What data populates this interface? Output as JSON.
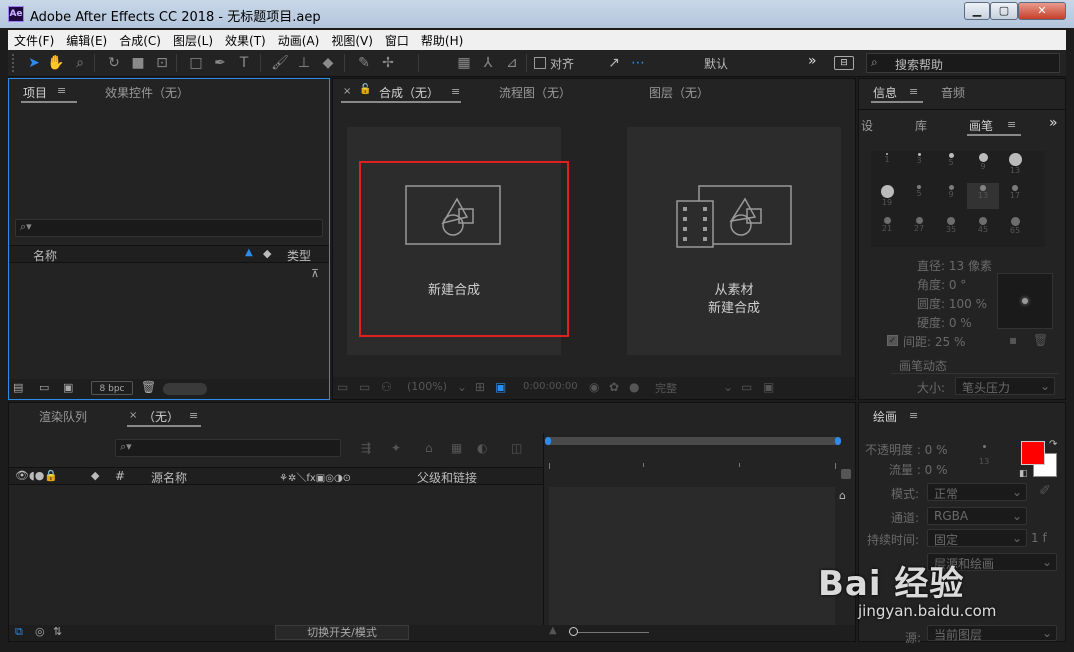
{
  "window": {
    "title": "Adobe After Effects CC 2018 - 无标题项目.aep",
    "logo": "Ae"
  },
  "menu": [
    "文件(F)",
    "编辑(E)",
    "合成(C)",
    "图层(L)",
    "效果(T)",
    "动画(A)",
    "视图(V)",
    "窗口",
    "帮助(H)"
  ],
  "toolbar": {
    "align_label": "对齐",
    "workspace": "默认",
    "search_placeholder": "搜索帮助"
  },
  "project_panel": {
    "tab_project": "项目",
    "tab_effects": "效果控件（无）",
    "col_name": "名称",
    "col_type": "类型",
    "bpc": "8 bpc"
  },
  "comp_panel": {
    "tab_comp": "合成（无）",
    "tab_flow": "流程图（无）",
    "tab_layer": "图层（无）",
    "new_comp": "新建合成",
    "from_footage_1": "从素材",
    "from_footage_2": "新建合成",
    "zoom": "(100%)",
    "timecode": "0:00:00:00",
    "quality": "完整"
  },
  "right_panel": {
    "tab_info": "信息",
    "tab_audio": "音频",
    "tab_settings": "设",
    "tab_library": "库",
    "tab_brush": "画笔",
    "brush_sizes": [
      "1",
      "3",
      "5",
      "9",
      "13",
      "19",
      "5",
      "9",
      "13",
      "17",
      "21",
      "27",
      "35",
      "45",
      "65"
    ],
    "diameter": "直径: 13 像素",
    "angle": "角度: 0 °",
    "roundness": "圆度: 100 %",
    "hardness": "硬度: 0 %",
    "spacing": "间距:   25 %",
    "brush_dynamics": "画笔动态",
    "size_label": "大小:",
    "size_value": "笔头压力"
  },
  "paint_panel": {
    "title": "绘画",
    "opacity": "不透明度 : 0 %",
    "flow": "流量 : 0 %",
    "mode_label": "模式:",
    "mode_value": "正常",
    "channel_label": "通道:",
    "channel_value": "RGBA",
    "duration_label": "持续时间:",
    "duration_value": "固定",
    "duration_extra": "1 f",
    "layer_source": "层源和绘画",
    "source_label": "源:",
    "source_value": "当前图层",
    "brush_size_small": "13",
    "fg_color": "#ff0000",
    "bg_color": "#ffffff"
  },
  "timeline": {
    "tab_render": "渲染队列",
    "tab_comp": "（无）",
    "col_source": "源名称",
    "col_parent": "父级和链接",
    "toggle_mode": "切换开关/模式"
  },
  "watermark": {
    "brand": "Bai 经验",
    "url": "jingyan.baidu.com"
  }
}
